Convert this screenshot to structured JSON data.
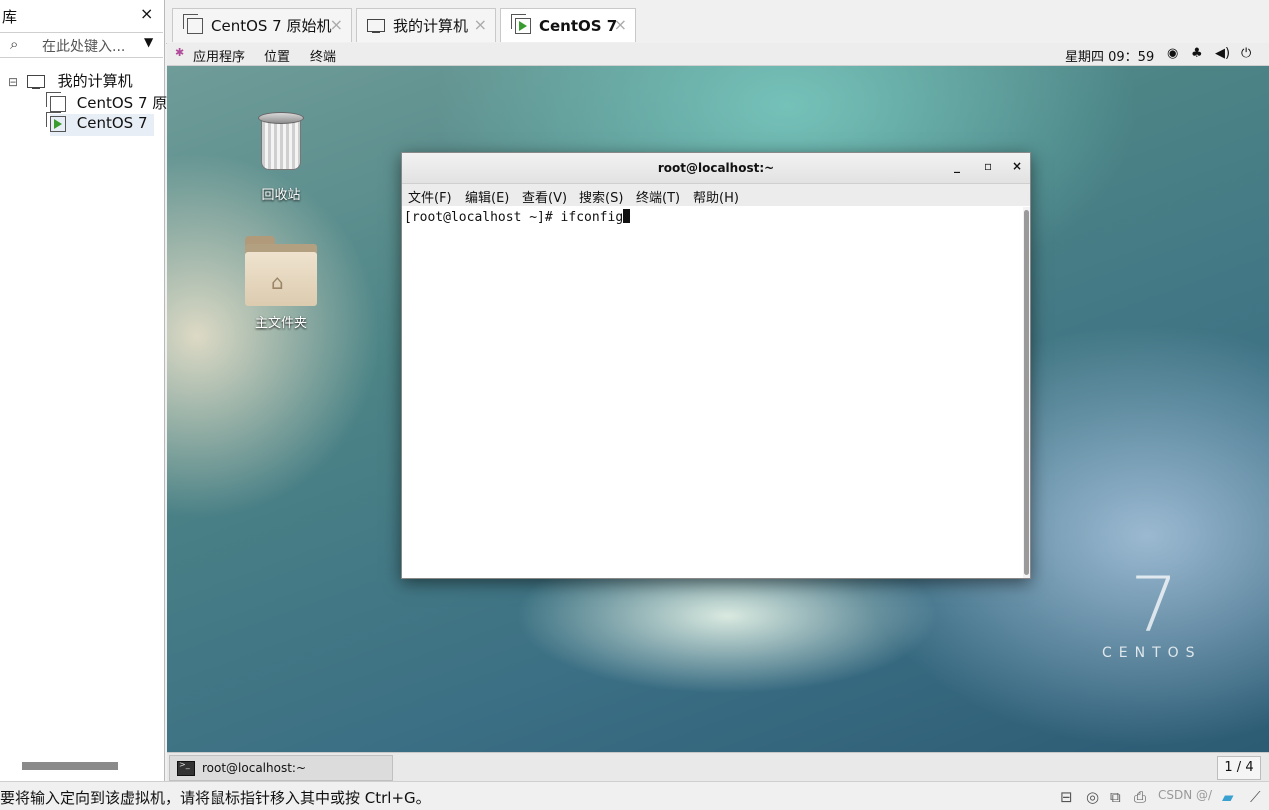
{
  "library": {
    "title": "库",
    "close": "×",
    "search_placeholder": "在此处键入...",
    "tree": {
      "root": "我的计算机",
      "items": [
        "CentOS 7 原",
        "CentOS 7"
      ]
    }
  },
  "tabs": [
    {
      "label": "CentOS 7 原始机",
      "close": "×"
    },
    {
      "label": "我的计算机",
      "close": "×"
    },
    {
      "label": "CentOS 7",
      "close": "×"
    }
  ],
  "guest_topbar": {
    "menu": [
      "应用程序",
      "位置",
      "终端"
    ],
    "clock": "星期四 09：59"
  },
  "desktop": {
    "icons": [
      "回收站",
      "主文件夹"
    ],
    "logo_number": "7",
    "logo_text": "CENTOS"
  },
  "terminal": {
    "title": "root@localhost:~",
    "buttons": [
      "_",
      "▫",
      "×"
    ],
    "menu": [
      "文件(F)",
      "编辑(E)",
      "查看(V)",
      "搜索(S)",
      "终端(T)",
      "帮助(H)"
    ],
    "prompt": "[root@localhost ~]# ",
    "command": "ifconfig"
  },
  "guest_taskbar": {
    "item": "root@localhost:~",
    "pager": "1 / 4"
  },
  "status_bar": {
    "text": "要将输入定向到该虚拟机，请将鼠标指针移入其中或按 Ctrl+G。",
    "watermark": "CSDN @/"
  }
}
